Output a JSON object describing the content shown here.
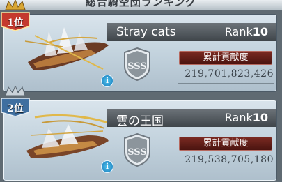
{
  "header": {
    "title": "総合騎空団ランキング"
  },
  "entries": [
    {
      "rank_position": "1位",
      "crew_name": "Stray cats",
      "rank_prefix": "Rank",
      "rank_value": "10",
      "grade": "SSS",
      "contribution_label": "累計貢献度",
      "contribution_value": "219,701,823,426",
      "info_icon_label": "i",
      "badge_color": "#c43a2e",
      "crown_color": "#d8a634"
    },
    {
      "rank_position": "2位",
      "crew_name": "雲の王国",
      "rank_prefix": "Rank",
      "rank_value": "10",
      "grade": "SSS",
      "contribution_label": "累計貢献度",
      "contribution_value": "219,538,705,180",
      "info_icon_label": "i",
      "badge_color": "#3f6fa0",
      "crown_color": "#c9d2d9"
    }
  ]
}
